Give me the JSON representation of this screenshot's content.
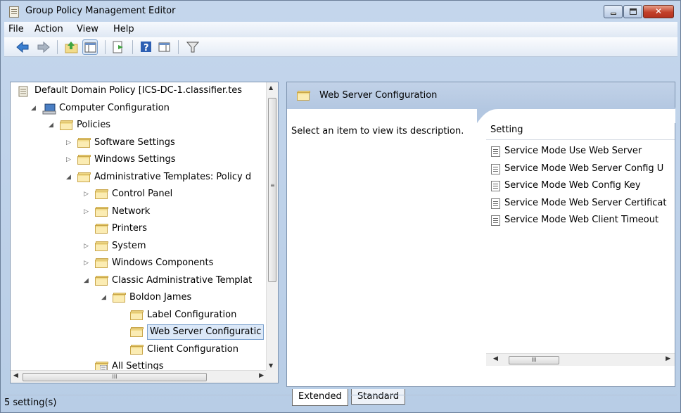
{
  "window": {
    "title": "Group Policy Management Editor"
  },
  "menu": [
    "File",
    "Action",
    "View",
    "Help"
  ],
  "tree": [
    {
      "label": "Default Domain Policy [ICS-DC-1.classifier.tes",
      "indent": 0,
      "twisty": ""
    },
    {
      "label": "Computer Configuration",
      "indent": 1,
      "twisty": "▲"
    },
    {
      "label": "Policies",
      "indent": 2,
      "twisty": "▲"
    },
    {
      "label": "Software Settings",
      "indent": 3,
      "twisty": "▷"
    },
    {
      "label": "Windows Settings",
      "indent": 3,
      "twisty": "▷"
    },
    {
      "label": "Administrative Templates: Policy d",
      "indent": 3,
      "twisty": "▲"
    },
    {
      "label": "Control Panel",
      "indent": 4,
      "twisty": "▷"
    },
    {
      "label": "Network",
      "indent": 4,
      "twisty": "▷"
    },
    {
      "label": "Printers",
      "indent": 4,
      "twisty": ""
    },
    {
      "label": "System",
      "indent": 4,
      "twisty": "▷"
    },
    {
      "label": "Windows Components",
      "indent": 4,
      "twisty": "▷"
    },
    {
      "label": "Classic Administrative Templat",
      "indent": 4,
      "twisty": "▲"
    },
    {
      "label": "Boldon James",
      "indent": 5,
      "twisty": "▲"
    },
    {
      "label": "Label Configuration",
      "indent": 6,
      "twisty": ""
    },
    {
      "label": "Web Server Configuratic",
      "indent": 6,
      "twisty": "",
      "selected": true
    },
    {
      "label": "Client Configuration",
      "indent": 6,
      "twisty": ""
    },
    {
      "label": "All Settings",
      "indent": 4,
      "twisty": ""
    }
  ],
  "right": {
    "title": "Web Server Configuration",
    "description": "Select an item to view its description.",
    "column_header": "Setting",
    "settings": [
      "Service Mode Use Web Server",
      "Service Mode Web Server Config U",
      "Service Mode Web Config Key",
      "Service Mode Web Server Certificat",
      "Service Mode Web Client Timeout"
    ]
  },
  "tabs": [
    "Extended",
    "Standard"
  ],
  "status": "5 setting(s)",
  "scroll_glyph": "III"
}
